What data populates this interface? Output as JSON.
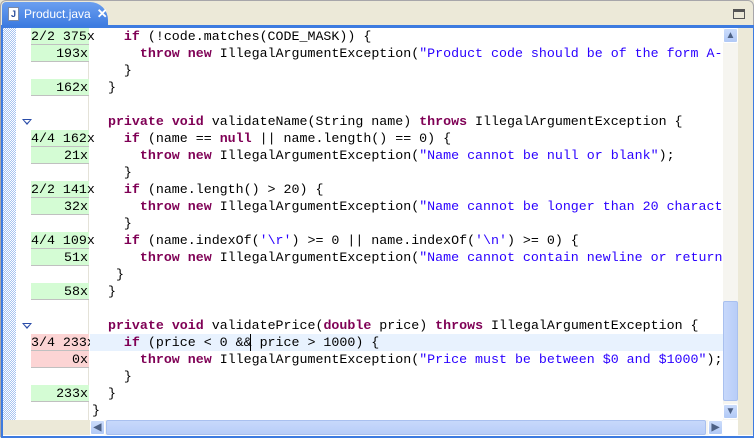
{
  "tab": {
    "title": "Product.java",
    "icon": "java-file-icon"
  },
  "gutter": [
    {
      "line": 1,
      "text": "2/2 375x",
      "status": "green"
    },
    {
      "line": 2,
      "text": "193x",
      "status": "green"
    },
    {
      "line": 4,
      "text": "162x",
      "status": "green"
    },
    {
      "line": 7,
      "text": "4/4 162x",
      "status": "green"
    },
    {
      "line": 8,
      "text": "21x",
      "status": "green"
    },
    {
      "line": 10,
      "text": "2/2 141x",
      "status": "green"
    },
    {
      "line": 11,
      "text": "32x",
      "status": "green"
    },
    {
      "line": 13,
      "text": "4/4 109x",
      "status": "green"
    },
    {
      "line": 14,
      "text": "51x",
      "status": "green"
    },
    {
      "line": 16,
      "text": "58x",
      "status": "green"
    },
    {
      "line": 19,
      "text": "3/4 233x",
      "status": "red"
    },
    {
      "line": 20,
      "text": "0x",
      "status": "red"
    },
    {
      "line": 22,
      "text": "233x",
      "status": "green"
    }
  ],
  "folds": [
    6,
    18
  ],
  "highlight_line": 19,
  "code": [
    [
      [
        "    ",
        "p"
      ],
      [
        "if",
        "kw"
      ],
      [
        " (!code.matches(CODE_MASK)) {",
        "p"
      ]
    ],
    [
      [
        "      ",
        "p"
      ],
      [
        "throw",
        "kw"
      ],
      [
        " ",
        "p"
      ],
      [
        "new",
        "kw"
      ],
      [
        " IllegalArgumentException(",
        "p"
      ],
      [
        "\"Product code should be of the form A-",
        "str"
      ]
    ],
    [
      [
        "    }",
        "p"
      ]
    ],
    [
      [
        "  }",
        "p"
      ]
    ],
    [],
    [
      [
        "  ",
        "p"
      ],
      [
        "private",
        "kw"
      ],
      [
        " ",
        "p"
      ],
      [
        "void",
        "kw"
      ],
      [
        " validateName(String name) ",
        "p"
      ],
      [
        "throws",
        "kw"
      ],
      [
        " IllegalArgumentException {",
        "p"
      ]
    ],
    [
      [
        "    ",
        "p"
      ],
      [
        "if",
        "kw"
      ],
      [
        " (name == ",
        "p"
      ],
      [
        "null",
        "kw"
      ],
      [
        " || name.length() == 0) {",
        "p"
      ]
    ],
    [
      [
        "      ",
        "p"
      ],
      [
        "throw",
        "kw"
      ],
      [
        " ",
        "p"
      ],
      [
        "new",
        "kw"
      ],
      [
        " IllegalArgumentException(",
        "p"
      ],
      [
        "\"Name cannot be null or blank\"",
        "str"
      ],
      [
        ");",
        "p"
      ]
    ],
    [
      [
        "    }",
        "p"
      ]
    ],
    [
      [
        "    ",
        "p"
      ],
      [
        "if",
        "kw"
      ],
      [
        " (name.length() > 20) {",
        "p"
      ]
    ],
    [
      [
        "      ",
        "p"
      ],
      [
        "throw",
        "kw"
      ],
      [
        " ",
        "p"
      ],
      [
        "new",
        "kw"
      ],
      [
        " IllegalArgumentException(",
        "p"
      ],
      [
        "\"Name cannot be longer than 20 charact",
        "str"
      ]
    ],
    [
      [
        "    }",
        "p"
      ]
    ],
    [
      [
        "    ",
        "p"
      ],
      [
        "if",
        "kw"
      ],
      [
        " (name.indexOf(",
        "p"
      ],
      [
        "'\\r'",
        "str"
      ],
      [
        ") >= 0 || name.indexOf(",
        "p"
      ],
      [
        "'\\n'",
        "str"
      ],
      [
        ") >= 0) {",
        "p"
      ]
    ],
    [
      [
        "      ",
        "p"
      ],
      [
        "throw",
        "kw"
      ],
      [
        " ",
        "p"
      ],
      [
        "new",
        "kw"
      ],
      [
        " IllegalArgumentException(",
        "p"
      ],
      [
        "\"Name cannot contain newline or return",
        "str"
      ]
    ],
    [
      [
        "   }",
        "p"
      ]
    ],
    [
      [
        "  }",
        "p"
      ]
    ],
    [],
    [
      [
        "  ",
        "p"
      ],
      [
        "private",
        "kw"
      ],
      [
        " ",
        "p"
      ],
      [
        "void",
        "kw"
      ],
      [
        " validatePrice(",
        "p"
      ],
      [
        "double",
        "kw"
      ],
      [
        " price) ",
        "p"
      ],
      [
        "throws",
        "kw"
      ],
      [
        " IllegalArgumentException {",
        "p"
      ]
    ],
    [
      [
        "    ",
        "p"
      ],
      [
        "if",
        "kw"
      ],
      [
        " (price < 0 && price > 1000) {",
        "p"
      ]
    ],
    [
      [
        "      ",
        "p"
      ],
      [
        "throw",
        "kw"
      ],
      [
        " ",
        "p"
      ],
      [
        "new",
        "kw"
      ],
      [
        " IllegalArgumentException(",
        "p"
      ],
      [
        "\"Price must be between $0 and $1000\"",
        "str"
      ],
      [
        ");",
        "p"
      ]
    ],
    [
      [
        "    }",
        "p"
      ]
    ],
    [
      [
        "  }",
        "p"
      ]
    ],
    [
      [
        "}",
        "p"
      ]
    ]
  ]
}
